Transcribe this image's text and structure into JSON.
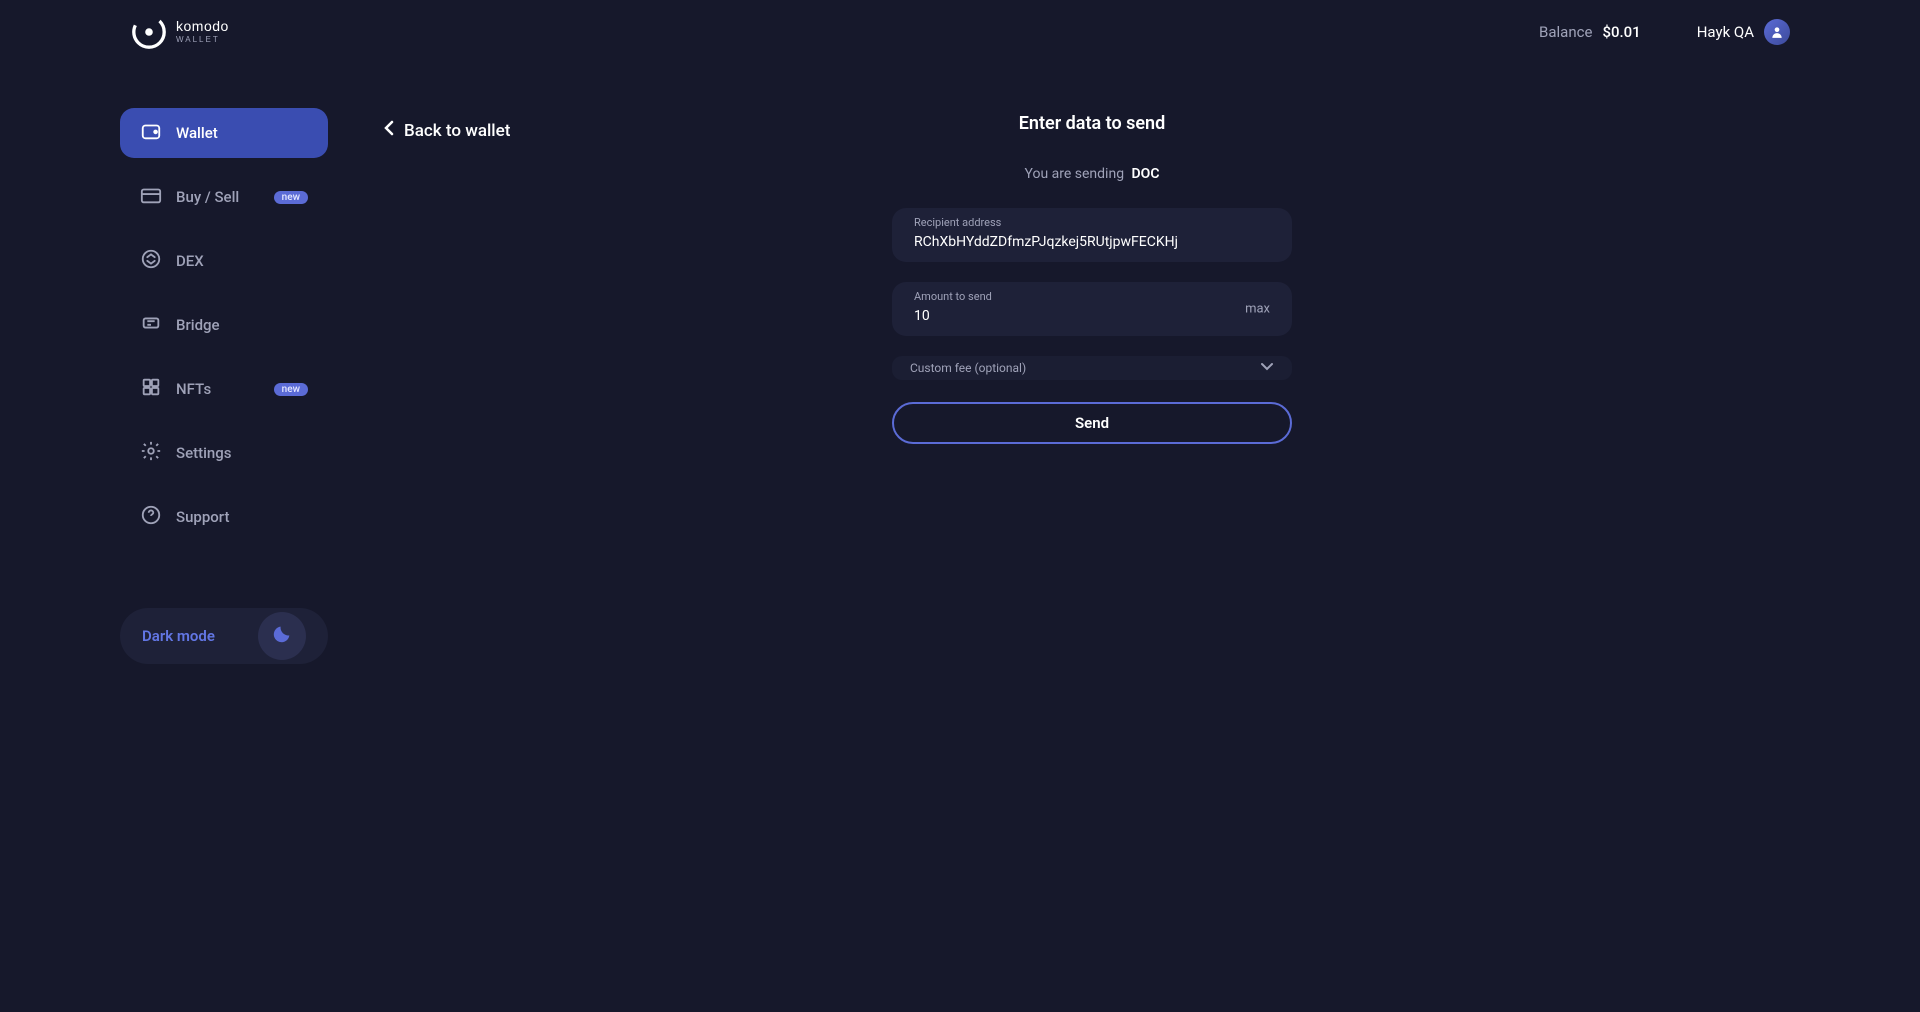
{
  "header": {
    "balance_label": "Balance",
    "balance_value": "$0.01",
    "user_name": "Hayk QA"
  },
  "sidebar": {
    "items": [
      {
        "label": "Wallet",
        "badge": null
      },
      {
        "label": "Buy / Sell",
        "badge": "new"
      },
      {
        "label": "DEX",
        "badge": null
      },
      {
        "label": "Bridge",
        "badge": null
      },
      {
        "label": "NFTs",
        "badge": "new"
      },
      {
        "label": "Settings",
        "badge": null
      },
      {
        "label": "Support",
        "badge": null
      }
    ],
    "dark_mode_label": "Dark mode"
  },
  "main": {
    "back_label": "Back to wallet",
    "title": "Enter data to send",
    "sending_prefix": "You are sending",
    "sending_asset": "DOC",
    "recipient_label": "Recipient address",
    "recipient_value": "RChXbHYddZDfmzPJqzkej5RUtjpwFECKHj",
    "amount_label": "Amount to send",
    "amount_value": "10",
    "max_label": "max",
    "custom_fee_label": "Custom fee (optional)",
    "send_btn": "Send"
  }
}
